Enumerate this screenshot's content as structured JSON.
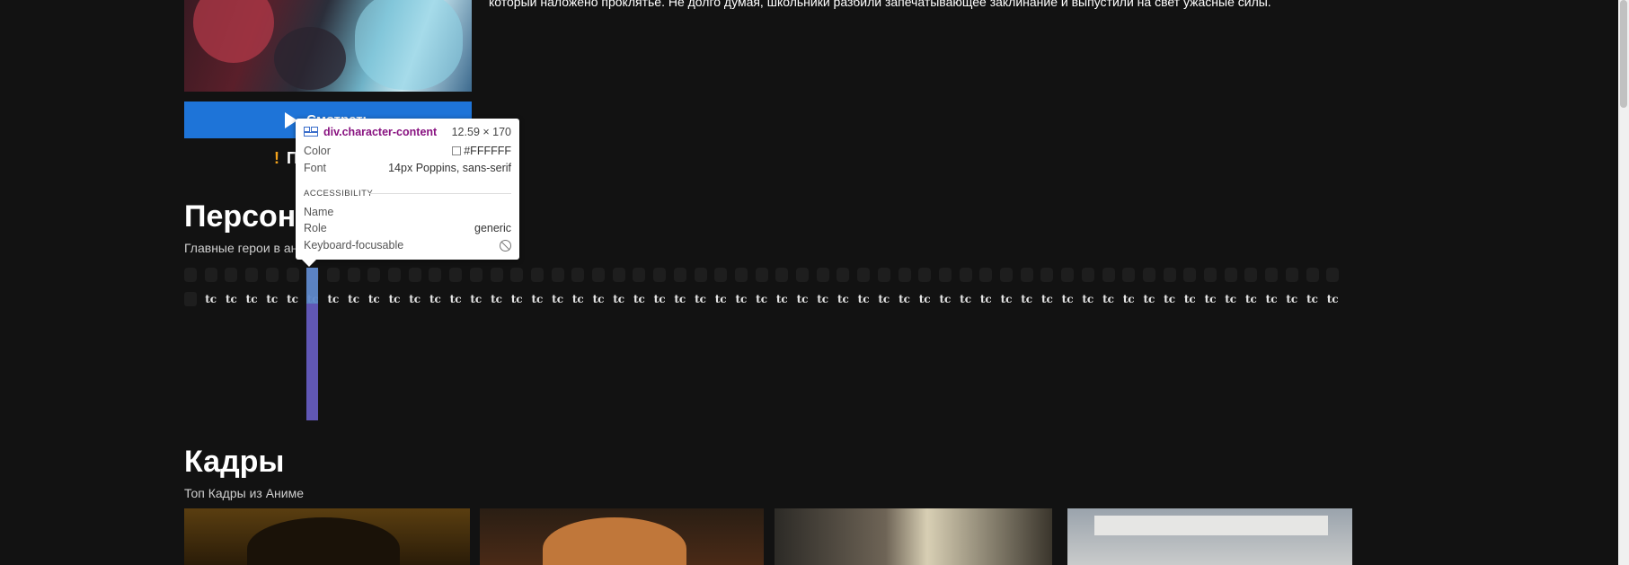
{
  "description": {
    "visible_line": "который наложено проклятье. Не долго думая, школьники разбили запечатывающее заклинание и выпустили на свет ужасные силы."
  },
  "player": {
    "watch_label": "Смотреть",
    "notice_text": "П"
  },
  "characters": {
    "title": "Персонажи",
    "subtitle": "Главные герои в аниме",
    "tile_glyph": "tc",
    "tile_count": 57
  },
  "devtools_tooltip": {
    "element": "div.character-content",
    "size": "12.59 × 170",
    "color_label": "Color",
    "color_value": "#FFFFFF",
    "font_label": "Font",
    "font_value": "14px Poppins, sans-serif",
    "section": "ACCESSIBILITY",
    "name_label": "Name",
    "name_value": "",
    "role_label": "Role",
    "role_value": "generic",
    "focusable_label": "Keyboard-focusable"
  },
  "frames": {
    "title": "Кадры",
    "subtitle": "Топ Кадры из Аниме"
  },
  "colors": {
    "background": "#121212",
    "accent": "#1e74d8",
    "warning": "#f3a21b",
    "highlight": "#6e64d2"
  }
}
